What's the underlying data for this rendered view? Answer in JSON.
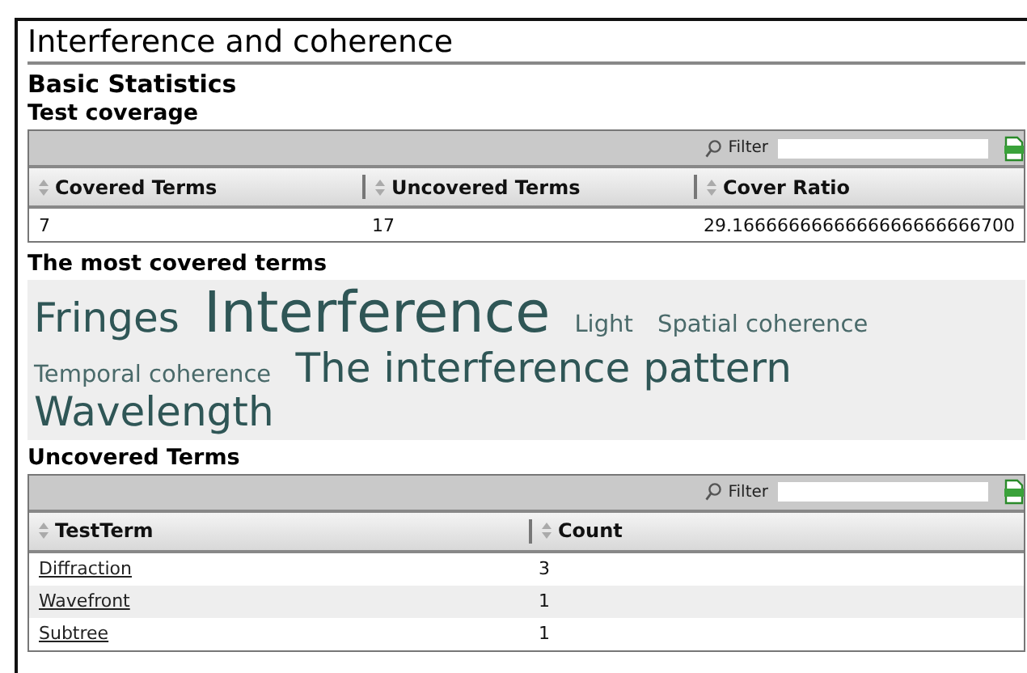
{
  "page": {
    "title": "Interference and coherence"
  },
  "basic_statistics": {
    "heading": "Basic Statistics",
    "subheading": "Test coverage",
    "table": {
      "filter_label": "Filter",
      "columns": [
        {
          "label": "Covered Terms",
          "kind": "text"
        },
        {
          "label": "Uncovered Terms",
          "kind": "text"
        },
        {
          "label": "Cover Ratio",
          "kind": "text"
        }
      ],
      "rows": [
        [
          "7",
          "17",
          "29.1666666666666666666666700"
        ]
      ]
    }
  },
  "most_covered": {
    "heading": "The most covered terms",
    "terms": [
      {
        "text": "Fringes",
        "kind": "large"
      },
      {
        "text": "Interference",
        "kind": "huge"
      },
      {
        "text": "Light",
        "kind": "small"
      },
      {
        "text": "Spatial coherence",
        "kind": "small"
      },
      {
        "text": "Temporal coherence",
        "kind": "small"
      },
      {
        "text": "The interference pattern",
        "kind": "large"
      },
      {
        "text": "Wavelength",
        "kind": "large"
      }
    ]
  },
  "uncovered": {
    "heading": "Uncovered Terms",
    "table": {
      "filter_label": "Filter",
      "columns": [
        {
          "label": "TestTerm",
          "kind": "link"
        },
        {
          "label": "Count",
          "kind": "text"
        }
      ],
      "rows": [
        [
          "Diffraction",
          "3"
        ],
        [
          "Wavefront",
          "1"
        ],
        [
          "Subtree",
          "1"
        ]
      ]
    }
  }
}
